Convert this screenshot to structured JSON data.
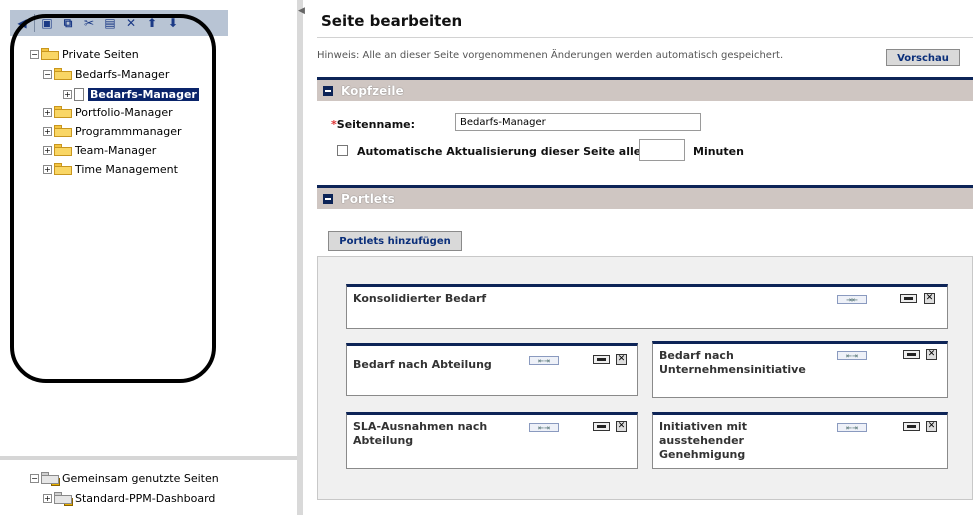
{
  "toolbar": {
    "buttons": [
      {
        "icon": "back-arrow-icon",
        "glyph": "◀"
      },
      {
        "icon": "new-page-icon",
        "glyph": "▣"
      },
      {
        "icon": "copy-icon",
        "glyph": "⧉"
      },
      {
        "icon": "cut-icon",
        "glyph": "✂"
      },
      {
        "icon": "paste-icon",
        "glyph": "▤"
      },
      {
        "icon": "delete-icon",
        "glyph": "✕"
      },
      {
        "icon": "move-up-icon",
        "glyph": "⬆"
      },
      {
        "icon": "move-down-icon",
        "glyph": "⬇"
      }
    ]
  },
  "tree": {
    "root_private": "Private Seiten",
    "bedarfs_folder": "Bedarfs-Manager",
    "bedarfs_page": "Bedarfs-Manager",
    "portfolio": "Portfolio-Manager",
    "programm": "Programmmanager",
    "team": "Team-Manager",
    "time": "Time Management",
    "root_shared": "Gemeinsam genutzte Seiten",
    "dashboard": "Standard-PPM-Dashboard"
  },
  "editor": {
    "title": "Seite bearbeiten",
    "hint": "Hinweis: Alle an dieser Seite vorgenommenen Änderungen werden automatisch gespeichert.",
    "preview_label": "Vorschau",
    "section_header": "Kopfzeile",
    "page_name_label": "Seitenname:",
    "page_name_required": "*",
    "page_name_value": "Bedarfs-Manager",
    "auto_refresh_label": "Automatische Aktualisierung dieser Seite alle",
    "auto_refresh_value": "",
    "minutes_label": "Minuten",
    "portlets_header": "Portlets",
    "add_portlets_label": "Portlets hinzufügen"
  },
  "portlets": [
    {
      "title": "Konsolidierter Bedarf"
    },
    {
      "title": "Bedarf nach Abteilung"
    },
    {
      "title": "Bedarf nach Unternehmensinitiative"
    },
    {
      "title": "SLA-Ausnahmen nach Abteilung"
    },
    {
      "title": "Initiativen mit ausstehender Genehmigung"
    }
  ],
  "colors": {
    "section_bar": "#0d2457",
    "section_bg": "#cfc6c2",
    "tree_selection": "#0a246a",
    "button_text": "#0b2f7a"
  }
}
